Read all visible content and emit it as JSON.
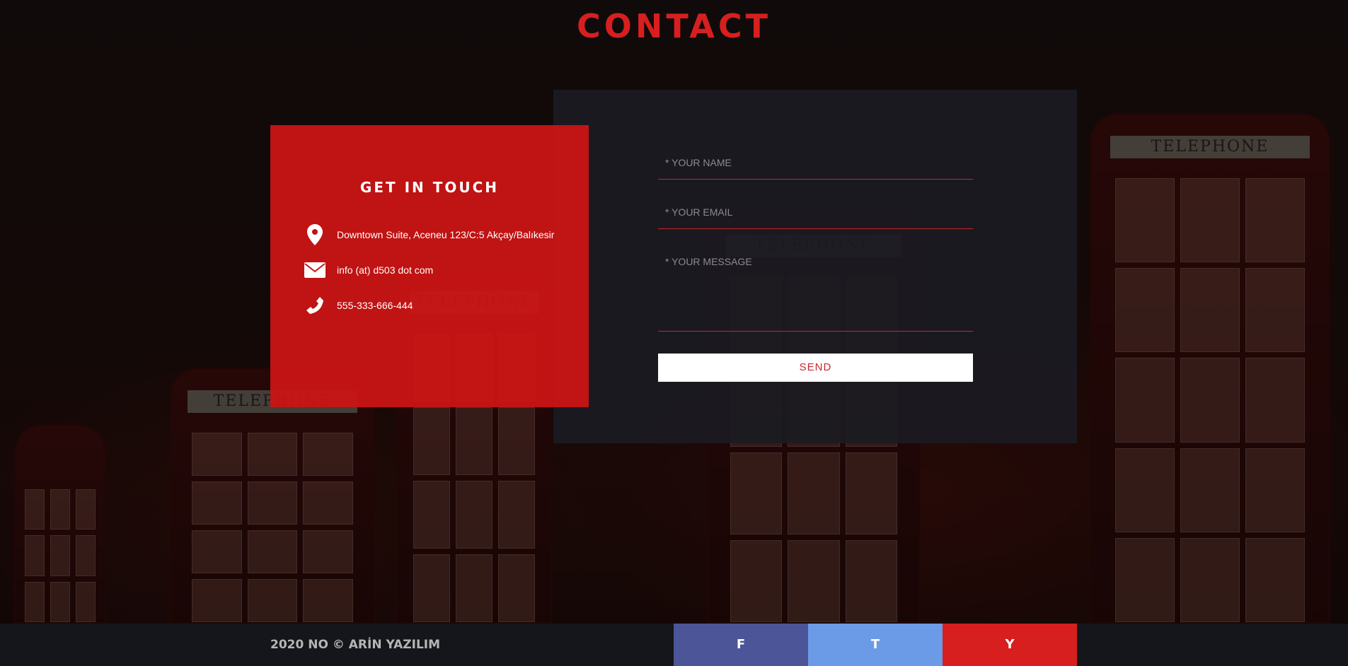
{
  "section": {
    "title": "CONTACT"
  },
  "info_card": {
    "heading": "GET IN TOUCH",
    "address": "Downtown Suite, Aceneu 123/C:5 Akçay/Balıkesir",
    "email": "info (at) d503 dot com",
    "phone": "555-333-666-444",
    "icons": [
      "map-pin-icon",
      "envelope-icon",
      "phone-icon"
    ]
  },
  "form": {
    "name_placeholder": "* YOUR NAME",
    "email_placeholder": "* YOUR EMAIL",
    "message_placeholder": "* YOUR MESSAGE",
    "send_label": "SEND"
  },
  "footer": {
    "copyright": "2020 NO © ARİN YAZILIM",
    "social": [
      {
        "label": "F",
        "color": "#4b5597"
      },
      {
        "label": "T",
        "color": "#6b9be6"
      },
      {
        "label": "Y",
        "color": "#d71f1f"
      }
    ]
  },
  "colors": {
    "accent": "#d71f1f",
    "panel": "#1b1b21",
    "footer": "#15161b"
  }
}
